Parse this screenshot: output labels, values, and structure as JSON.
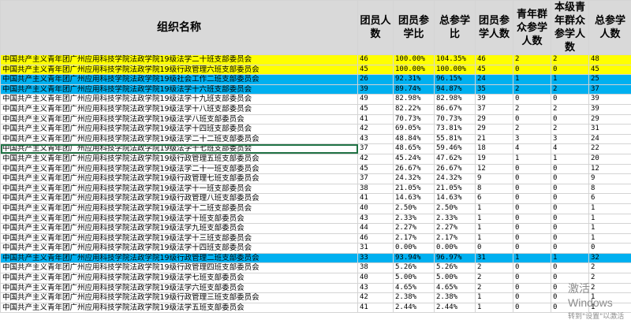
{
  "headers": [
    "组织名称",
    "团员人数",
    "团员参学比",
    "总参学比",
    "团员参学人数",
    "青年群众参学人数",
    "本级青年群众参学人数",
    "总参学人数"
  ],
  "rows": [
    {
      "name": "中国共产主义青年团广州应用科技学院法政学院19级法学二十班支部委员会",
      "m": "46",
      "r1": "100.00%",
      "r2": "104.35%",
      "p": "46",
      "y": "2",
      "z": "2",
      "t": "48",
      "hl": "yellow"
    },
    {
      "name": "中国共产主义青年团广州应用科技学院法政学院19级行政管理六班支部委员会",
      "m": "45",
      "r1": "100.00%",
      "r2": "100.00%",
      "p": "45",
      "y": "0",
      "z": "0",
      "t": "45",
      "hl": "yellow"
    },
    {
      "name": "中国共产主义青年团广州应用科技学院法政学院19级社会工作二班支部委员会",
      "m": "26",
      "r1": "92.31%",
      "r2": "96.15%",
      "p": "24",
      "y": "1",
      "z": "1",
      "t": "25",
      "hl": "blue"
    },
    {
      "name": "中国共产主义青年团广州应用科技学院法政学院19级法学十六班支部委员会",
      "m": "39",
      "r1": "89.74%",
      "r2": "94.87%",
      "p": "35",
      "y": "2",
      "z": "2",
      "t": "37",
      "hl": "blue"
    },
    {
      "name": "中国共产主义青年团广州应用科技学院法政学院19级法学十九班支部委员会",
      "m": "49",
      "r1": "82.98%",
      "r2": "82.98%",
      "p": "39",
      "y": "0",
      "z": "0",
      "t": "39",
      "hl": ""
    },
    {
      "name": "中国共产主义青年团广州应用科技学院法政学院19级法学十八班支部委员会",
      "m": "45",
      "r1": "82.22%",
      "r2": "86.67%",
      "p": "37",
      "y": "2",
      "z": "2",
      "t": "39",
      "hl": ""
    },
    {
      "name": "中国共产主义青年团广州应用科技学院法政学院19级法学八班支部委员会",
      "m": "41",
      "r1": "70.73%",
      "r2": "70.73%",
      "p": "29",
      "y": "0",
      "z": "0",
      "t": "29",
      "hl": ""
    },
    {
      "name": "中国共产主义青年团广州应用科技学院法政学院19级法学十四班支部委员会",
      "m": "42",
      "r1": "69.05%",
      "r2": "73.81%",
      "p": "29",
      "y": "2",
      "z": "2",
      "t": "31",
      "hl": ""
    },
    {
      "name": "中国共产主义青年团广州应用科技学院法政学院19级法学二十二班支部委员会",
      "m": "43",
      "r1": "48.84%",
      "r2": "55.81%",
      "p": "21",
      "y": "3",
      "z": "3",
      "t": "24",
      "hl": ""
    },
    {
      "name": "中国共产主义青年团广州应用科技学院法政学院19级法学十七班支部委员会",
      "m": "37",
      "r1": "48.65%",
      "r2": "59.46%",
      "p": "18",
      "y": "4",
      "z": "4",
      "t": "22",
      "hl": "",
      "sel": true
    },
    {
      "name": "中国共产主义青年团广州应用科技学院法政学院19级行政管理五班支部委员会",
      "m": "42",
      "r1": "45.24%",
      "r2": "47.62%",
      "p": "19",
      "y": "1",
      "z": "1",
      "t": "20",
      "hl": ""
    },
    {
      "name": "中国共产主义青年团广州应用科技学院法政学院19级法学二十一班支部委员会",
      "m": "45",
      "r1": "26.67%",
      "r2": "26.67%",
      "p": "12",
      "y": "0",
      "z": "0",
      "t": "12",
      "hl": ""
    },
    {
      "name": "中国共产主义青年团广州应用科技学院法政学院19级行政管理七班支部委员会",
      "m": "37",
      "r1": "24.32%",
      "r2": "24.32%",
      "p": "9",
      "y": "0",
      "z": "0",
      "t": "9",
      "hl": ""
    },
    {
      "name": "中国共产主义青年团广州应用科技学院法政学院19级法学十一班支部委员会",
      "m": "38",
      "r1": "21.05%",
      "r2": "21.05%",
      "p": "8",
      "y": "0",
      "z": "0",
      "t": "8",
      "hl": ""
    },
    {
      "name": "中国共产主义青年团广州应用科技学院法政学院19级行政管理八班支部委员会",
      "m": "41",
      "r1": "14.63%",
      "r2": "14.63%",
      "p": "6",
      "y": "0",
      "z": "0",
      "t": "6",
      "hl": ""
    },
    {
      "name": "中国共产主义青年团广州应用科技学院法政学院19级法学十二班支部委员会",
      "m": "40",
      "r1": "2.50%",
      "r2": "2.50%",
      "p": "1",
      "y": "0",
      "z": "0",
      "t": "1",
      "hl": ""
    },
    {
      "name": "中国共产主义青年团广州应用科技学院法政学院19级法学十班支部委员会",
      "m": "43",
      "r1": "2.33%",
      "r2": "2.33%",
      "p": "1",
      "y": "0",
      "z": "0",
      "t": "1",
      "hl": ""
    },
    {
      "name": "中国共产主义青年团广州应用科技学院法政学院19级法学九班支部委员会",
      "m": "44",
      "r1": "2.27%",
      "r2": "2.27%",
      "p": "1",
      "y": "0",
      "z": "0",
      "t": "1",
      "hl": ""
    },
    {
      "name": "中国共产主义青年团广州应用科技学院法政学院19级法学十三班支部委员会",
      "m": "46",
      "r1": "2.17%",
      "r2": "2.17%",
      "p": "1",
      "y": "0",
      "z": "0",
      "t": "1",
      "hl": ""
    },
    {
      "name": "中国共产主义青年团广州应用科技学院法政学院19级法学十四班支部委员会",
      "m": "31",
      "r1": "0.00%",
      "r2": "0.00%",
      "p": "0",
      "y": "0",
      "z": "0",
      "t": "0",
      "hl": ""
    },
    {
      "name": "中国共产主义青年团广州应用科技学院法政学院19级行政管理二班支部委员会",
      "m": "33",
      "r1": "93.94%",
      "r2": "96.97%",
      "p": "31",
      "y": "1",
      "z": "1",
      "t": "32",
      "hl": "blue"
    },
    {
      "name": "中国共产主义青年团广州应用科技学院法政学院19级行政管理四班支部委员会",
      "m": "38",
      "r1": "5.26%",
      "r2": "5.26%",
      "p": "2",
      "y": "0",
      "z": "0",
      "t": "2",
      "hl": ""
    },
    {
      "name": "中国共产主义青年团广州应用科技学院法政学院19级法学七班支部委员会",
      "m": "40",
      "r1": "5.00%",
      "r2": "5.00%",
      "p": "2",
      "y": "0",
      "z": "0",
      "t": "2",
      "hl": ""
    },
    {
      "name": "中国共产主义青年团广州应用科技学院法政学院19级法学六班支部委员会",
      "m": "43",
      "r1": "4.65%",
      "r2": "4.65%",
      "p": "2",
      "y": "0",
      "z": "0",
      "t": "2",
      "hl": ""
    },
    {
      "name": "中国共产主义青年团广州应用科技学院法政学院19级行政管理三班支部委员会",
      "m": "42",
      "r1": "2.38%",
      "r2": "2.38%",
      "p": "1",
      "y": "0",
      "z": "0",
      "t": "1",
      "hl": ""
    },
    {
      "name": "中国共产主义青年团广州应用科技学院法政学院19级法学五班支部委员会",
      "m": "41",
      "r1": "2.44%",
      "r2": "2.44%",
      "p": "1",
      "y": "0",
      "z": "0",
      "t": "1",
      "hl": ""
    }
  ],
  "watermark": {
    "line1": "激活 Windows",
    "line2": "转到\"设置\"以激活"
  },
  "colors": {
    "header": "#d9d9d9",
    "yellow": "#ffff00",
    "blue": "#00b0f0",
    "selection": "#217346"
  }
}
